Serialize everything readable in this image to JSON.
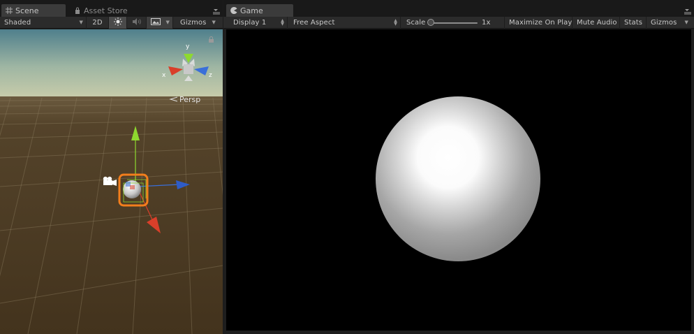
{
  "scene": {
    "tabs": [
      {
        "label": "Scene",
        "icon": "grid-icon",
        "active": true
      },
      {
        "label": "Asset Store",
        "icon": "lock-bag-icon",
        "active": false
      }
    ],
    "toolbar": {
      "shading_mode": "Shaded",
      "mode_2d": "2D",
      "gizmos": "Gizmos"
    },
    "view_gizmo": {
      "axis_y": "y",
      "axis_x": "x",
      "axis_z": "z",
      "projection": "Persp"
    }
  },
  "game": {
    "tab": {
      "label": "Game",
      "icon": "pacman-icon",
      "active": true
    },
    "toolbar": {
      "display": "Display 1",
      "aspect": "Free Aspect",
      "scale_label": "Scale",
      "scale_value": "1x",
      "maximize_on_play": "Maximize On Play",
      "mute_audio": "Mute Audio",
      "stats": "Stats",
      "gizmos": "Gizmos"
    }
  },
  "colors": {
    "accent_selected": "#f27e1c",
    "axis_x": "#d93f2a",
    "axis_y": "#8ed92f",
    "axis_z": "#3a6fd9",
    "ground": "#4a3a22",
    "sky_top": "#4e7f8e"
  }
}
